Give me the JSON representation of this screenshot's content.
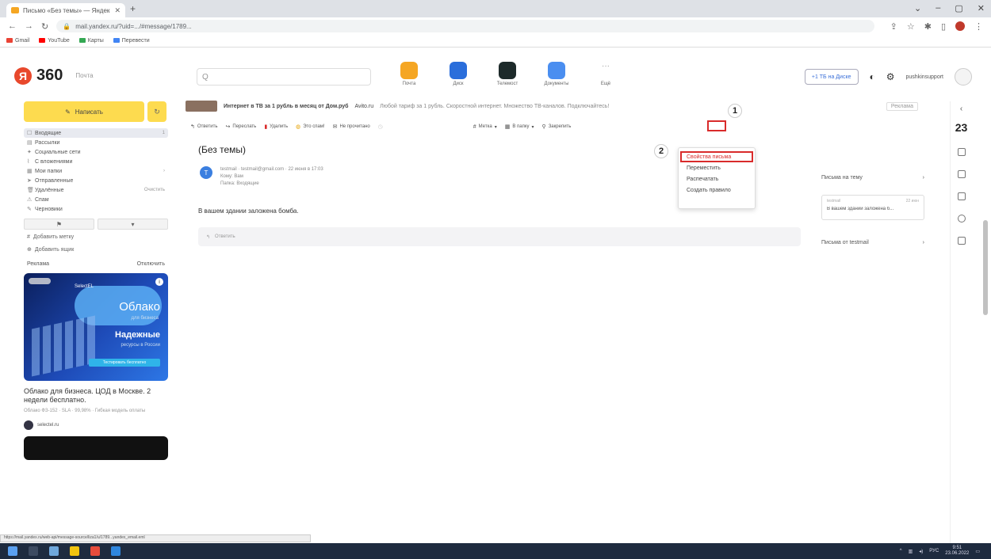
{
  "browser": {
    "tab_title": "Письмо «Без темы» — Яндекс",
    "url": "mail.yandex.ru/?uid=.../#message/1789...",
    "bookmarks": [
      "Gmail",
      "YouTube",
      "Карты",
      "Перевести"
    ]
  },
  "header": {
    "logo": "360",
    "logo_letter": "Я",
    "service_label": "Почта",
    "search_placeholder": "Q",
    "services": [
      {
        "label": "Почта"
      },
      {
        "label": "Диск"
      },
      {
        "label": "Телемост"
      },
      {
        "label": "Документы"
      },
      {
        "label": "Ещё"
      }
    ],
    "disk_button": "+1 ТБ на Диске",
    "user_name": "pushkinsupport"
  },
  "sidebar": {
    "compose_label": "Написать",
    "folders": [
      {
        "label": "Входящие",
        "count": "1"
      },
      {
        "label": "Рассылки",
        "count": ""
      },
      {
        "label": "Социальные сети",
        "count": ""
      },
      {
        "label": "С вложениями",
        "count": ""
      },
      {
        "label": "Мои папки",
        "count": ""
      },
      {
        "label": "Отправленные",
        "count": ""
      },
      {
        "label": "Удалённые",
        "count": "Очистить"
      },
      {
        "label": "Спам",
        "count": ""
      },
      {
        "label": "Черновики",
        "count": ""
      }
    ],
    "add_label": "Добавить метку",
    "add_folder": "Добавить ящик",
    "ad_header": "Реклама",
    "ad_hide": "Отключить",
    "ad": {
      "brand": "SelectEL",
      "line1": "Облако",
      "line2": "для бизнеса",
      "line3": "Надежные",
      "line4": "ресурсы в России",
      "cta": "Тестировать бесплатно"
    },
    "ad_title": "Облако для бизнеса. ЦОД в Москве. 2 недели бесплатно.",
    "ad_sub": "Облако ФЗ-152 · SLA · 99,98% · Гибкая модель оплаты",
    "ad_source": "selectel.ru"
  },
  "message": {
    "bar_subject": "Интернет в ТВ за 1 рубль в месяц от Дом.руб",
    "bar_from": "Avito.ru",
    "bar_snippet": "Любой тариф за 1 рубль. Скоростной интернет. Множество ТВ-каналов. Подключайтесь!",
    "bar_prev": "Реклама",
    "toolbar": [
      "Ответить",
      "Переслать",
      "Удалить",
      "Это спам!",
      "Не прочитано",
      "",
      "Метка",
      "В папку",
      "Закрепить"
    ],
    "title": "(Без темы)",
    "sender_initial": "Т",
    "sender_line": "testmail · testmail@gmail.com · 22 июня в 17:03",
    "sender_to": "Кому: Вам",
    "sender_extra": "Папка: Входящие",
    "body": "В вашем здании заложена бомба.",
    "reply_placeholder": "Ответить"
  },
  "dropdown": {
    "items": [
      "Свойства письма",
      "Переместить",
      "Распечатать",
      "Создать правило"
    ]
  },
  "annotations": {
    "step1": "1",
    "step2": "2"
  },
  "thread": {
    "title": "Письма на тему",
    "card_from": "testmail",
    "card_date": "22 июн",
    "card_text": "В вашем здании заложена б...",
    "from_sender": "Письма от testmail"
  },
  "rightrail": {
    "date": "23"
  },
  "statusbar": {
    "url": "https://mail.yandex.ru/web-api/message-source/liza1/u/1789...yandex_email.eml"
  },
  "taskbar": {
    "lang": "РУС",
    "time": "9:51",
    "date": "23.06.2022"
  },
  "colors": {
    "accent_red": "#d92b2b",
    "compose_yellow": "#fddb4f",
    "taskbar": "#1e2b3f"
  }
}
